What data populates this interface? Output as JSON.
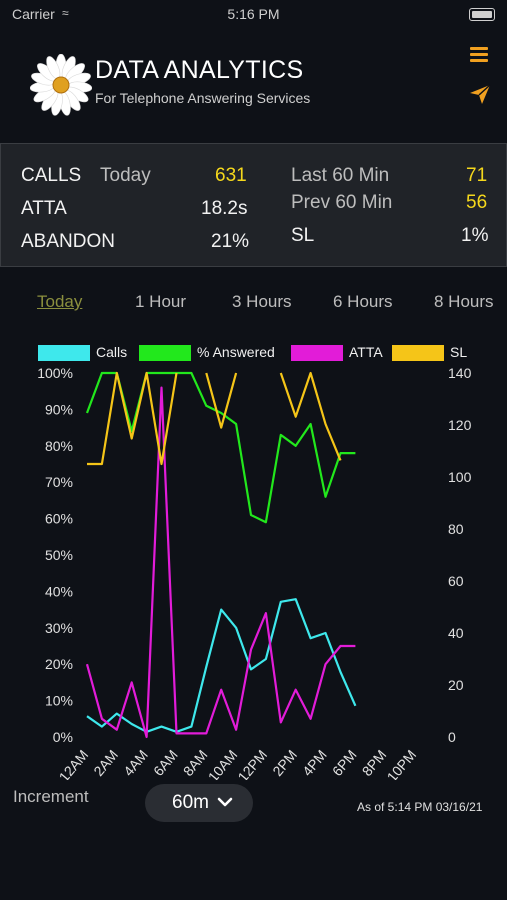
{
  "status_bar": {
    "carrier": "Carrier",
    "time": "5:16 PM"
  },
  "header": {
    "title": "DATA ANALYTICS",
    "subtitle": "For Telephone Answering Services",
    "icons": {
      "menu": "hamburger-icon",
      "send": "send-icon",
      "logo": "daisy-logo"
    },
    "accent": "#f0a020"
  },
  "stats": {
    "calls_label": "CALLS",
    "today_label": "Today",
    "today_value": "631",
    "atta_label": "ATTA",
    "atta_value": "18.2s",
    "abandon_label": "ABANDON",
    "abandon_value": "21%",
    "last60_label": "Last 60 Min",
    "last60_value": "71",
    "prev60_label": "Prev 60 Min",
    "prev60_value": "56",
    "sl_label": "SL",
    "sl_value": "1%"
  },
  "tabs": [
    "Today",
    "1 Hour",
    "3 Hours",
    "6 Hours",
    "8 Hours"
  ],
  "active_tab": "Today",
  "chart_data": {
    "type": "line",
    "x_labels": [
      "12AM",
      "2AM",
      "4AM",
      "6AM",
      "8AM",
      "10AM",
      "12PM",
      "2PM",
      "4PM",
      "6PM",
      "8PM",
      "10PM"
    ],
    "left_axis": {
      "ticks": [
        "100%",
        "90%",
        "80%",
        "70%",
        "60%",
        "50%",
        "40%",
        "30%",
        "20%",
        "10%",
        "0%"
      ],
      "range": [
        0,
        100
      ]
    },
    "right_axis": {
      "ticks": [
        "140",
        "120",
        "100",
        "80",
        "60",
        "40",
        "20",
        "0"
      ],
      "range": [
        0,
        140
      ]
    },
    "series": [
      {
        "name": "Calls",
        "color": "#3ee8ec",
        "axis": "right",
        "x": [
          0,
          1,
          2,
          3,
          4,
          5,
          6,
          7,
          8,
          9,
          10,
          11,
          12,
          13,
          14,
          15,
          16,
          17,
          18
        ],
        "y": [
          8,
          4,
          9,
          5,
          2,
          4,
          2,
          4,
          27,
          49,
          42,
          26,
          30,
          52,
          53,
          38,
          40,
          25,
          12
        ]
      },
      {
        "name": "% Answered",
        "color": "#22e81c",
        "axis": "left",
        "x": [
          0,
          1,
          2,
          3,
          4,
          5,
          6,
          7,
          8,
          9,
          10,
          11,
          12,
          13,
          14,
          15,
          16,
          17,
          18
        ],
        "y": [
          89,
          100,
          100,
          84,
          100,
          100,
          100,
          100,
          91,
          89,
          86,
          61,
          59,
          83,
          80,
          86,
          66,
          78,
          78
        ]
      },
      {
        "name": "ATTA",
        "color": "#e21cd8",
        "axis": "left",
        "x": [
          0,
          1,
          2,
          3,
          4,
          5,
          6,
          7,
          8,
          9,
          10,
          11,
          12,
          13,
          14,
          15,
          16,
          17,
          18
        ],
        "y": [
          20,
          5,
          2,
          15,
          0,
          96,
          1,
          1,
          1,
          13,
          2,
          24,
          34,
          4,
          13,
          5,
          20,
          25,
          25
        ]
      },
      {
        "name": "SL",
        "color": "#f5c518",
        "axis": "left",
        "x": [
          0,
          1,
          2,
          3,
          4,
          5,
          6,
          7,
          8,
          9,
          10,
          11,
          12,
          13,
          14,
          15,
          16,
          17,
          18
        ],
        "y": [
          75,
          75,
          100,
          82,
          100,
          75,
          100,
          null,
          100,
          85,
          100,
          null,
          null,
          100,
          88,
          100,
          86,
          76,
          null
        ]
      }
    ]
  },
  "increment": {
    "label": "Increment",
    "value": "60m",
    "icon": "chevron-down-icon"
  },
  "as_of": "As of 5:14 PM 03/16/21"
}
